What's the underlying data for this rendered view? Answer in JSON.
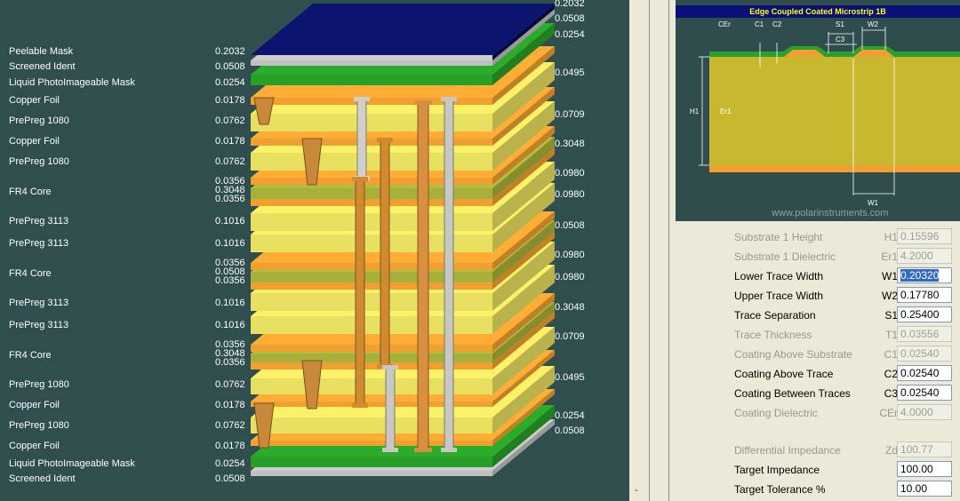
{
  "stackup": {
    "layers": [
      {
        "name": "Peelable Mask",
        "value": "0.2032"
      },
      {
        "name": "Screened Ident",
        "value": "0.0508"
      },
      {
        "name": "Liquid PhotoImageable Mask",
        "value": "0.0254"
      },
      {
        "name": "Copper Foil",
        "value": "0.0178"
      },
      {
        "name": "PrePreg 1080",
        "value": "0.0762"
      },
      {
        "name": "Copper Foil",
        "value": "0.0178"
      },
      {
        "name": "PrePreg 1080",
        "value": "0.0762"
      },
      {
        "name": "FR4 Core",
        "value": "0.0356",
        "value2": "0.3048",
        "value3": "0.0356"
      },
      {
        "name": "PrePreg 3113",
        "value": "0.1016"
      },
      {
        "name": "PrePreg 3113",
        "value": "0.1016"
      },
      {
        "name": "FR4 Core",
        "value": "0.0356",
        "value2": "0.0508",
        "value3": "0.0356"
      },
      {
        "name": "PrePreg 3113",
        "value": "0.1016"
      },
      {
        "name": "PrePreg 3113",
        "value": "0.1016"
      },
      {
        "name": "FR4 Core",
        "value": "0.0356",
        "value2": "0.3048",
        "value3": "0.0356"
      },
      {
        "name": "PrePreg 1080",
        "value": "0.0762"
      },
      {
        "name": "Copper Foil",
        "value": "0.0178"
      },
      {
        "name": "PrePreg 1080",
        "value": "0.0762"
      },
      {
        "name": "Copper Foil",
        "value": "0.0178"
      },
      {
        "name": "Liquid PhotoImageable Mask",
        "value": "0.0254"
      },
      {
        "name": "Screened Ident",
        "value": "0.0508"
      }
    ],
    "right_values": [
      "0.2032",
      "0.0508",
      "0.0254",
      "0.0495",
      "0.0709",
      "0.3048",
      "0.0980",
      "0.0980",
      "0.0508",
      "0.0980",
      "0.0980",
      "0.3048",
      "0.0709",
      "0.0495",
      "0.0254",
      "0.0508"
    ],
    "colors": {
      "mask_top": "#0d1470",
      "prepreg": "#e8e060",
      "core": "#a6b03a",
      "copper": "#f0a030",
      "solder": "#28a028"
    }
  },
  "diagram": {
    "title": "Edge Coupled Coated Microstrip 1B",
    "labels": {
      "cer": "CEr",
      "c1": "C1",
      "c2": "C2",
      "c3": "C3",
      "s1": "S1",
      "w2": "W2",
      "h1": "H1",
      "er1": "Er1",
      "w1": "W1"
    },
    "watermark": "www.polarinstruments.com"
  },
  "params": [
    {
      "label": "Substrate 1 Height",
      "symbol": "H1",
      "value": "0.15596",
      "disabled": true
    },
    {
      "label": "Substrate 1 Dielectric",
      "symbol": "Er1",
      "value": "4.2000",
      "disabled": true
    },
    {
      "label": "Lower Trace Width",
      "symbol": "W1",
      "value": "0.20320",
      "disabled": false,
      "selected": true
    },
    {
      "label": "Upper Trace Width",
      "symbol": "W2",
      "value": "0.17780",
      "disabled": false
    },
    {
      "label": "Trace Separation",
      "symbol": "S1",
      "value": "0.25400",
      "disabled": false
    },
    {
      "label": "Trace Thickness",
      "symbol": "T1",
      "value": "0.03556",
      "disabled": true
    },
    {
      "label": "Coating Above Substrate",
      "symbol": "C1",
      "value": "0.02540",
      "disabled": true
    },
    {
      "label": "Coating Above Trace",
      "symbol": "C2",
      "value": "0.02540",
      "disabled": false
    },
    {
      "label": "Coating Between Traces",
      "symbol": "C3",
      "value": "0.02540",
      "disabled": false
    },
    {
      "label": "Coating Dielectric",
      "symbol": "CEr",
      "value": "4.0000",
      "disabled": true
    },
    {
      "label": "Differential Impedance",
      "symbol": "Zd",
      "value": "100.77",
      "disabled": true
    },
    {
      "label": "Target Impedance",
      "symbol": "",
      "value": "100.00",
      "disabled": false
    },
    {
      "label": "Target Tolerance %",
      "symbol": "",
      "value": "10.00",
      "disabled": false
    }
  ],
  "divider_mark": "-"
}
